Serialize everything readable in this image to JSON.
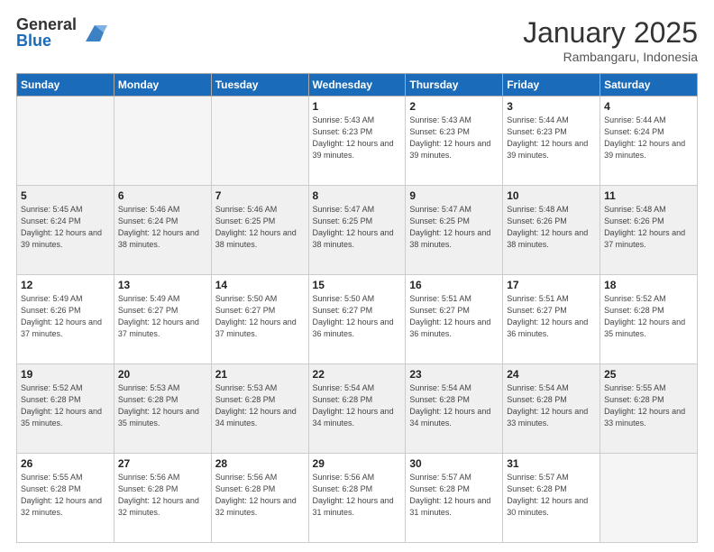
{
  "logo": {
    "general": "General",
    "blue": "Blue"
  },
  "header": {
    "month": "January 2025",
    "location": "Rambangaru, Indonesia"
  },
  "days_of_week": [
    "Sunday",
    "Monday",
    "Tuesday",
    "Wednesday",
    "Thursday",
    "Friday",
    "Saturday"
  ],
  "weeks": [
    [
      {
        "day": "",
        "info": ""
      },
      {
        "day": "",
        "info": ""
      },
      {
        "day": "",
        "info": ""
      },
      {
        "day": "1",
        "info": "Sunrise: 5:43 AM\nSunset: 6:23 PM\nDaylight: 12 hours and 39 minutes."
      },
      {
        "day": "2",
        "info": "Sunrise: 5:43 AM\nSunset: 6:23 PM\nDaylight: 12 hours and 39 minutes."
      },
      {
        "day": "3",
        "info": "Sunrise: 5:44 AM\nSunset: 6:23 PM\nDaylight: 12 hours and 39 minutes."
      },
      {
        "day": "4",
        "info": "Sunrise: 5:44 AM\nSunset: 6:24 PM\nDaylight: 12 hours and 39 minutes."
      }
    ],
    [
      {
        "day": "5",
        "info": "Sunrise: 5:45 AM\nSunset: 6:24 PM\nDaylight: 12 hours and 39 minutes."
      },
      {
        "day": "6",
        "info": "Sunrise: 5:46 AM\nSunset: 6:24 PM\nDaylight: 12 hours and 38 minutes."
      },
      {
        "day": "7",
        "info": "Sunrise: 5:46 AM\nSunset: 6:25 PM\nDaylight: 12 hours and 38 minutes."
      },
      {
        "day": "8",
        "info": "Sunrise: 5:47 AM\nSunset: 6:25 PM\nDaylight: 12 hours and 38 minutes."
      },
      {
        "day": "9",
        "info": "Sunrise: 5:47 AM\nSunset: 6:25 PM\nDaylight: 12 hours and 38 minutes."
      },
      {
        "day": "10",
        "info": "Sunrise: 5:48 AM\nSunset: 6:26 PM\nDaylight: 12 hours and 38 minutes."
      },
      {
        "day": "11",
        "info": "Sunrise: 5:48 AM\nSunset: 6:26 PM\nDaylight: 12 hours and 37 minutes."
      }
    ],
    [
      {
        "day": "12",
        "info": "Sunrise: 5:49 AM\nSunset: 6:26 PM\nDaylight: 12 hours and 37 minutes."
      },
      {
        "day": "13",
        "info": "Sunrise: 5:49 AM\nSunset: 6:27 PM\nDaylight: 12 hours and 37 minutes."
      },
      {
        "day": "14",
        "info": "Sunrise: 5:50 AM\nSunset: 6:27 PM\nDaylight: 12 hours and 37 minutes."
      },
      {
        "day": "15",
        "info": "Sunrise: 5:50 AM\nSunset: 6:27 PM\nDaylight: 12 hours and 36 minutes."
      },
      {
        "day": "16",
        "info": "Sunrise: 5:51 AM\nSunset: 6:27 PM\nDaylight: 12 hours and 36 minutes."
      },
      {
        "day": "17",
        "info": "Sunrise: 5:51 AM\nSunset: 6:27 PM\nDaylight: 12 hours and 36 minutes."
      },
      {
        "day": "18",
        "info": "Sunrise: 5:52 AM\nSunset: 6:28 PM\nDaylight: 12 hours and 35 minutes."
      }
    ],
    [
      {
        "day": "19",
        "info": "Sunrise: 5:52 AM\nSunset: 6:28 PM\nDaylight: 12 hours and 35 minutes."
      },
      {
        "day": "20",
        "info": "Sunrise: 5:53 AM\nSunset: 6:28 PM\nDaylight: 12 hours and 35 minutes."
      },
      {
        "day": "21",
        "info": "Sunrise: 5:53 AM\nSunset: 6:28 PM\nDaylight: 12 hours and 34 minutes."
      },
      {
        "day": "22",
        "info": "Sunrise: 5:54 AM\nSunset: 6:28 PM\nDaylight: 12 hours and 34 minutes."
      },
      {
        "day": "23",
        "info": "Sunrise: 5:54 AM\nSunset: 6:28 PM\nDaylight: 12 hours and 34 minutes."
      },
      {
        "day": "24",
        "info": "Sunrise: 5:54 AM\nSunset: 6:28 PM\nDaylight: 12 hours and 33 minutes."
      },
      {
        "day": "25",
        "info": "Sunrise: 5:55 AM\nSunset: 6:28 PM\nDaylight: 12 hours and 33 minutes."
      }
    ],
    [
      {
        "day": "26",
        "info": "Sunrise: 5:55 AM\nSunset: 6:28 PM\nDaylight: 12 hours and 32 minutes."
      },
      {
        "day": "27",
        "info": "Sunrise: 5:56 AM\nSunset: 6:28 PM\nDaylight: 12 hours and 32 minutes."
      },
      {
        "day": "28",
        "info": "Sunrise: 5:56 AM\nSunset: 6:28 PM\nDaylight: 12 hours and 32 minutes."
      },
      {
        "day": "29",
        "info": "Sunrise: 5:56 AM\nSunset: 6:28 PM\nDaylight: 12 hours and 31 minutes."
      },
      {
        "day": "30",
        "info": "Sunrise: 5:57 AM\nSunset: 6:28 PM\nDaylight: 12 hours and 31 minutes."
      },
      {
        "day": "31",
        "info": "Sunrise: 5:57 AM\nSunset: 6:28 PM\nDaylight: 12 hours and 30 minutes."
      },
      {
        "day": "",
        "info": ""
      }
    ]
  ]
}
